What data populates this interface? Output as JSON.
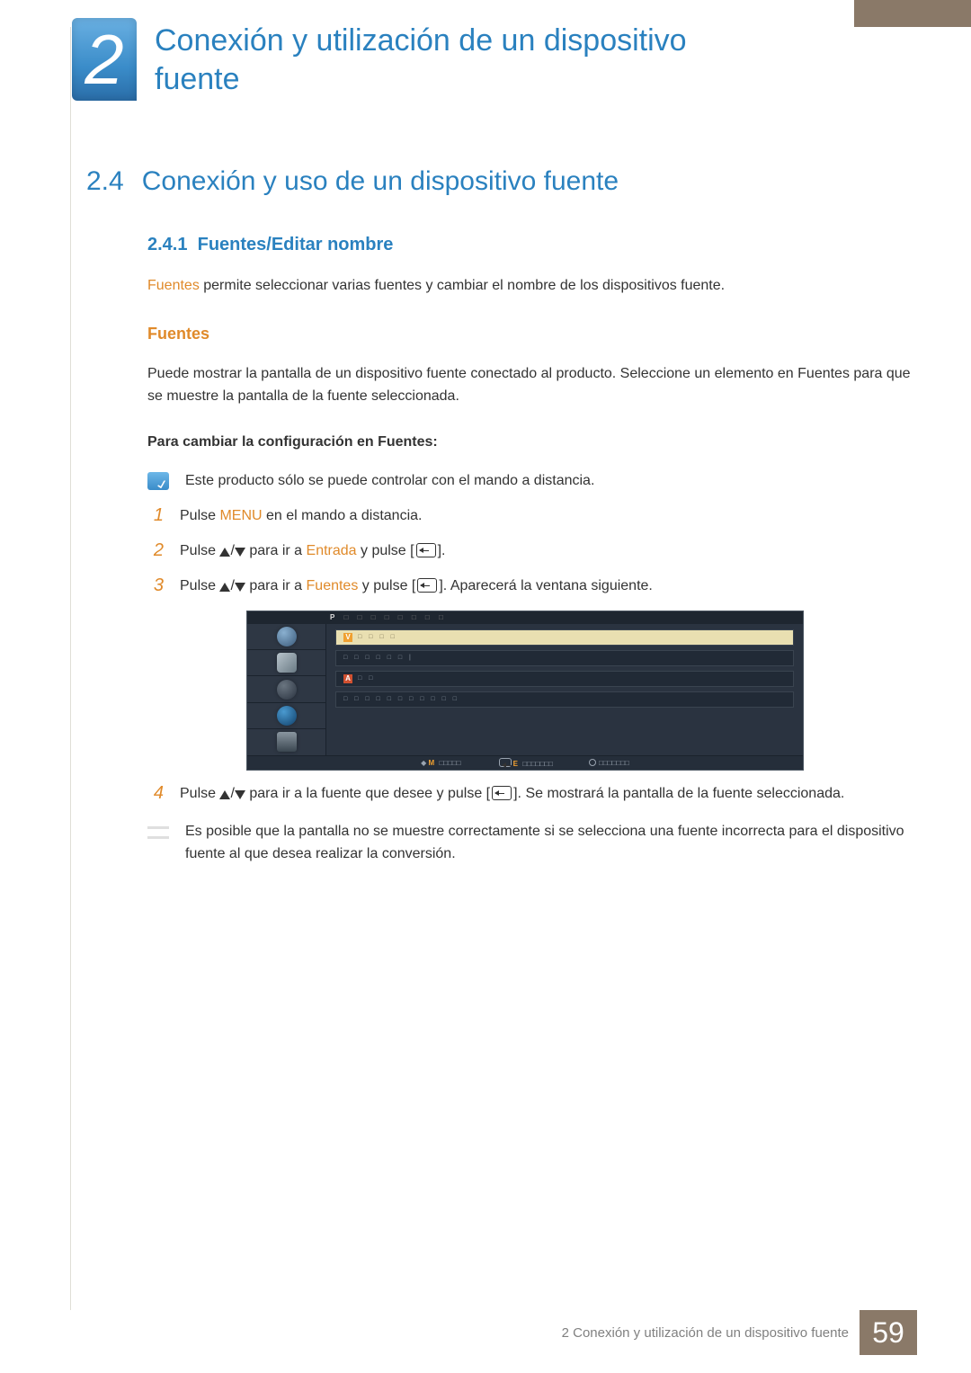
{
  "chapter": {
    "number": "2",
    "title": "Conexión y utilización de un dispositivo fuente"
  },
  "section": {
    "number": "2.4",
    "title": "Conexión y uso de un dispositivo fuente"
  },
  "subsection": {
    "number": "2.4.1",
    "title": "Fuentes/Editar nombre"
  },
  "intro": {
    "keyword": "Fuentes",
    "rest": " permite seleccionar varias fuentes y cambiar el nombre de los dispositivos fuente."
  },
  "fuentes_heading": "Fuentes",
  "fuentes_para_a": "Puede mostrar la pantalla de un dispositivo fuente conectado al producto. Seleccione un elemento en ",
  "fuentes_para_b": "Fuentes",
  "fuentes_para_c": " para que se muestre la pantalla de la fuente seleccionada.",
  "config_heading": "Para cambiar la configuración en Fuentes:",
  "remote_note": "Este producto sólo se puede controlar con el mando a distancia.",
  "steps": {
    "s1": {
      "num": "1",
      "a": "Pulse ",
      "menu": "MENU",
      "b": " en el mando a distancia."
    },
    "s2": {
      "num": "2",
      "a": "Pulse ",
      "b": " para ir a ",
      "entrada": "Entrada",
      "c": " y pulse [",
      "d": "]."
    },
    "s3": {
      "num": "3",
      "a": "Pulse ",
      "b": " para ir a ",
      "fuentes": "Fuentes",
      "c": " y pulse [",
      "d": "]. Aparecerá la ventana siguiente."
    },
    "s4": {
      "num": "4",
      "a": "Pulse ",
      "b": " para ir a la fuente que desee y pulse [",
      "c": "]. Se mostrará la pantalla de la fuente seleccionada."
    }
  },
  "osd": {
    "top_letter": "P",
    "bar": {
      "move_label": "M",
      "enter_label": "E"
    }
  },
  "warning": "Es posible que la pantalla no se muestre correctamente si se selecciona una fuente incorrecta para el dispositivo fuente al que desea realizar la conversión.",
  "footer": {
    "text": "2 Conexión y utilización de un dispositivo fuente",
    "page": "59"
  }
}
